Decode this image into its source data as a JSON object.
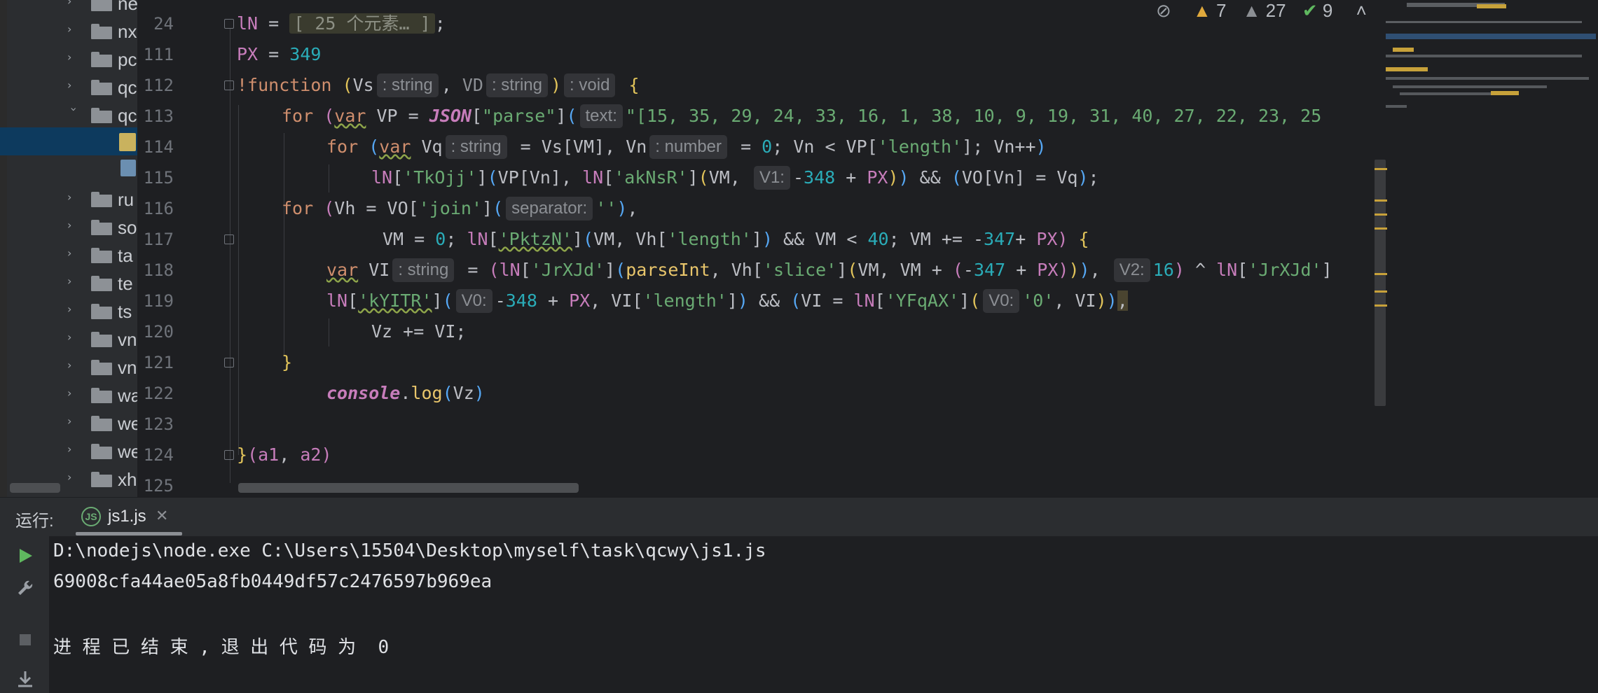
{
  "project_tree": {
    "items": [
      {
        "label": "ne",
        "expanded": false
      },
      {
        "label": "nx",
        "expanded": false
      },
      {
        "label": "pc",
        "expanded": false
      },
      {
        "label": "qc",
        "expanded": false
      },
      {
        "label": "qc",
        "expanded": true
      },
      {
        "label": "",
        "expanded": false
      },
      {
        "label": "",
        "expanded": false
      },
      {
        "label": "ru",
        "expanded": false
      },
      {
        "label": "so",
        "expanded": false
      },
      {
        "label": "ta",
        "expanded": false
      },
      {
        "label": "te",
        "expanded": false
      },
      {
        "label": "ts",
        "expanded": false
      },
      {
        "label": "vn",
        "expanded": false
      },
      {
        "label": "vn",
        "expanded": false
      },
      {
        "label": "wa",
        "expanded": false
      },
      {
        "label": "we",
        "expanded": false
      },
      {
        "label": "we",
        "expanded": false
      },
      {
        "label": "xh",
        "expanded": false
      }
    ]
  },
  "inspections": {
    "warnings": "7",
    "weak_warnings": "27",
    "typos": "9"
  },
  "editor": {
    "line_numbers": [
      "24",
      "111",
      "112",
      "113",
      "114",
      "115",
      "116",
      "117",
      "118",
      "119",
      "120",
      "121",
      "122",
      "123",
      "124",
      "125"
    ],
    "collapsed_text": "[ 25 个元素… ]",
    "hints": {
      "string": ": string",
      "void": ": void",
      "number": ": number",
      "text": "text:",
      "v1": "V1:",
      "separator": "separator:",
      "v2": "V2:",
      "v0": "V0:"
    },
    "array_literal": "\"[15, 35, 29, 24, 33, 16, 1, 38, 10, 9, 19, 31, 40, 27, 22, 23, 25"
  },
  "run_panel": {
    "title": "运行:",
    "tab_label": "js1.js",
    "output": [
      "D:\\nodejs\\node.exe C:\\Users\\15504\\Desktop\\myself\\task\\qcwy\\js1.js",
      "69008cfa44ae05a8fb0449df57c2476597b969ea",
      "",
      "进 程 已 结 束 , 退 出 代 码 为  0"
    ]
  },
  "colors": {
    "editor_bg": "#1e1f22",
    "keyword": "#cf8e6d",
    "string": "#6aab73",
    "number": "#2aacb8",
    "property": "#c77dbb",
    "function": "#56a8f5",
    "warning": "#e0a93c"
  },
  "icons": {
    "run": "play-icon",
    "wrench": "wrench-icon",
    "stop": "stop-icon",
    "scroll": "scroll-to-end-icon",
    "eye": "eye-crossed-icon"
  }
}
